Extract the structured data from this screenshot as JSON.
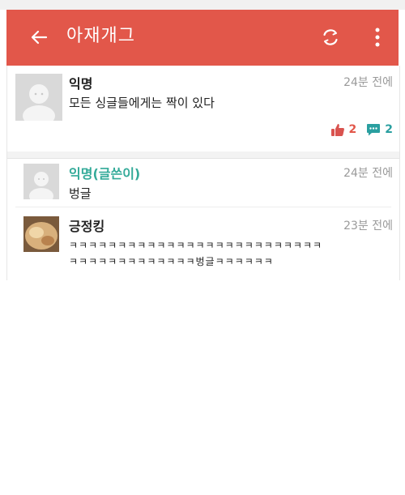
{
  "header": {
    "title": "아재개그"
  },
  "colors": {
    "appbar": "#e2574a",
    "op_author": "#33aa99",
    "like": "#e2574a",
    "comment": "#2a9fa0"
  },
  "icons": {
    "back": "arrow-left-icon",
    "refresh": "refresh-icon",
    "more": "more-vertical-icon",
    "like": "thumbs-up-icon",
    "comment": "comment-icon"
  },
  "post": {
    "author": "익명",
    "time": "24분 전에",
    "content": "모든 싱글들에게는 짝이 있다",
    "likes": "2",
    "comments": "2"
  },
  "comments": [
    {
      "author": "익명(글쓴이)",
      "time": "24분 전에",
      "content": "벙글"
    },
    {
      "author": "긍정킹",
      "time": "23분 전에",
      "line1": "ㅋㅋㅋㅋㅋㅋㅋㅋㅋㅋㅋㅋㅋㅋㅋㅋㅋㅋㅋㅋㅋㅋㅋㅋㅋㅋ",
      "line2": "ㅋㅋㅋㅋㅋㅋㅋㅋㅋㅋㅋㅋㅋ벙글ㅋㅋㅋㅋㅋㅋ"
    }
  ]
}
